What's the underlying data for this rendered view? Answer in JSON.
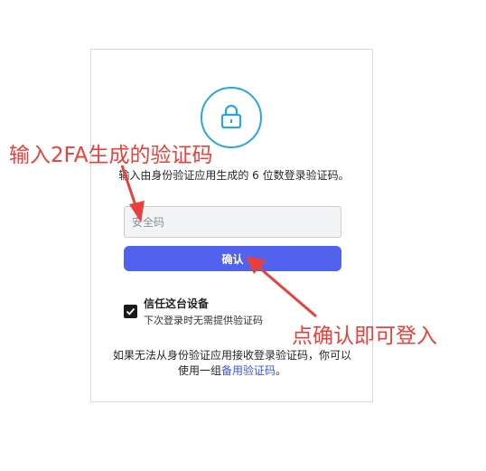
{
  "login": {
    "instruction": "输入由身份验证应用生成的 6 位数登录验证码。",
    "code_placeholder": "安全码",
    "confirm_label": "确认",
    "trust_device_title": "信任这台设备",
    "trust_device_subtitle": "下次登录时无需提供验证码",
    "trust_device_checked": true,
    "backup_prefix": "如果无法从身份验证应用接收登录验证码，你可以使用一组",
    "backup_link": "备用验证码",
    "backup_suffix": "。"
  },
  "annotations": {
    "step1": "输入2FA生成的验证码",
    "step2": "点确认即可登入"
  },
  "colors": {
    "accent": "#5162ef",
    "lock_ring": "#2aa6d8",
    "annotation": "#e8403a",
    "link": "#3b56d6"
  },
  "icons": [
    "lock-icon",
    "check-icon"
  ]
}
